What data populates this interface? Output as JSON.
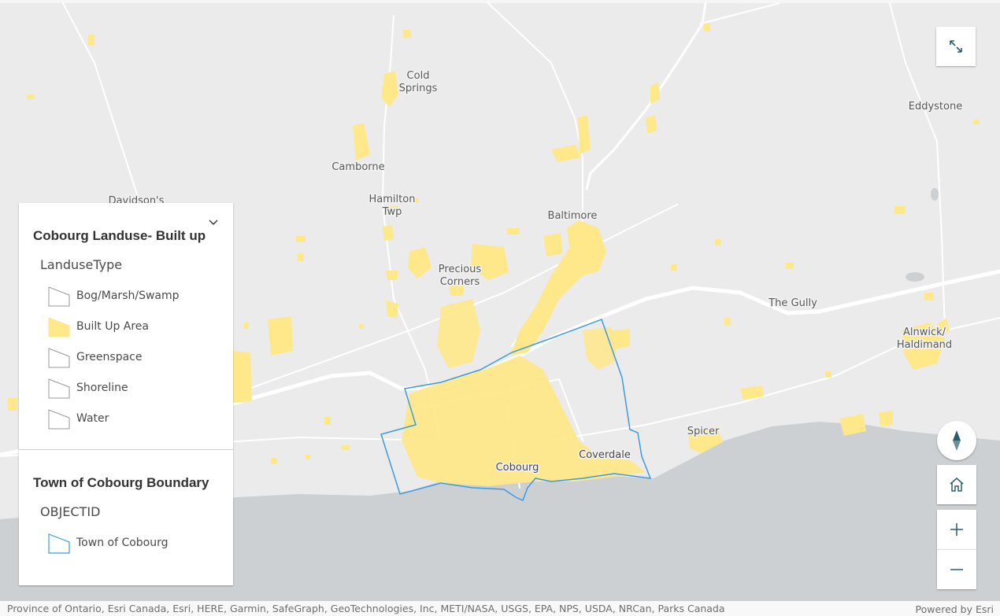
{
  "map": {
    "colors": {
      "land": "#ebebeb",
      "water": "#cdd0d2",
      "built_up": "#ffe88a",
      "boundary": "#3c9be0",
      "roads": "#ffffff"
    },
    "places": {
      "cold_springs_line1": "Cold",
      "cold_springs_line2": "Springs",
      "eddystone": "Eddystone",
      "camborne": "Camborne",
      "davidsons": "Davidson's",
      "hamilton_line1": "Hamilton",
      "hamilton_line2": "Twp",
      "baltimore": "Baltimore",
      "precious_line1": "Precious",
      "precious_line2": "Corners",
      "the_gully": "The Gully",
      "alnwick_line1": "Alnwick/",
      "alnwick_line2": "Haldimand",
      "spicer": "Spicer",
      "coverdale": "Coverdale",
      "cobourg": "Cobourg"
    }
  },
  "legend": {
    "layer1": {
      "title": "Cobourg Landuse- Built up",
      "field": "LanduseType",
      "items": [
        {
          "label": "Bog/Marsh/Swamp",
          "fill": "#ffffff"
        },
        {
          "label": "Built Up Area",
          "fill": "#ffe88a"
        },
        {
          "label": "Greenspace",
          "fill": "#ffffff"
        },
        {
          "label": "Shoreline",
          "fill": "#ffffff"
        },
        {
          "label": "Water",
          "fill": "#ffffff"
        }
      ]
    },
    "layer2": {
      "title": "Town of Cobourg Boundary",
      "field": "OBJECTID",
      "items": [
        {
          "label": "Town of Cobourg",
          "stroke": "#3c9be0"
        }
      ]
    }
  },
  "controls": {
    "fullscreen_icon": "expand-icon",
    "compass_icon": "compass-icon",
    "home_icon": "home-icon",
    "zoom_in_icon": "plus-icon",
    "zoom_out_icon": "minus-icon",
    "collapse_icon": "chevron-down-icon"
  },
  "attribution": {
    "sources": "Province of Ontario, Esri Canada, Esri, HERE, Garmin, SafeGraph, GeoTechnologies, Inc, METI/NASA, USGS, EPA, NPS, USDA, NRCan, Parks Canada",
    "powered_by": "Powered by Esri"
  }
}
